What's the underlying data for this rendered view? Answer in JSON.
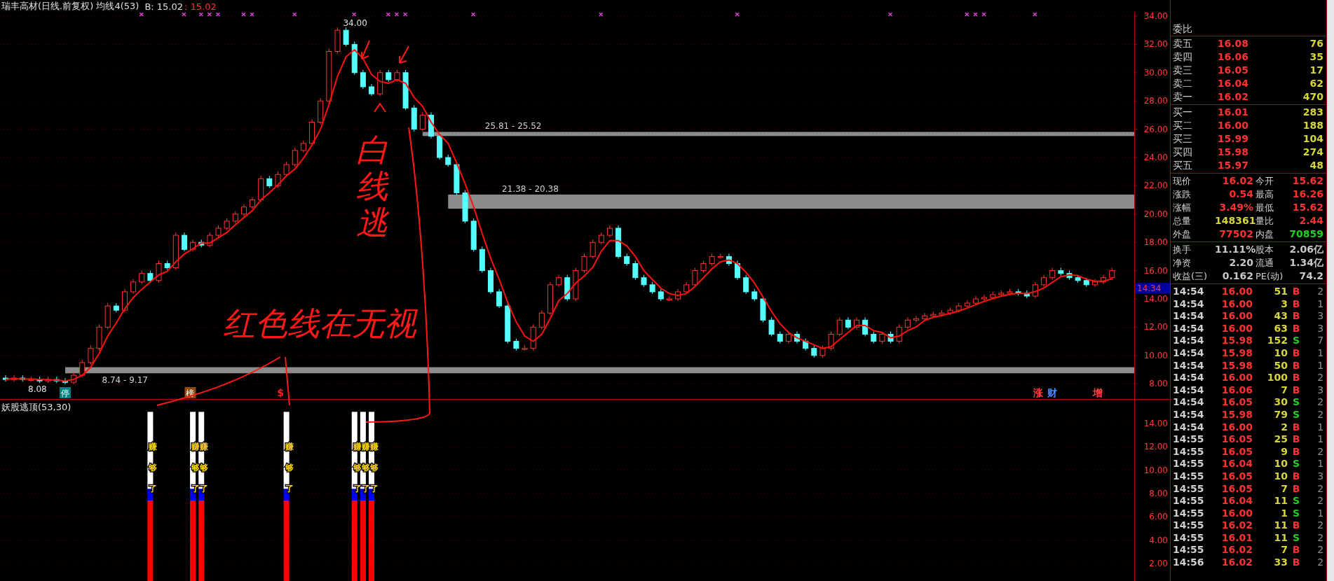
{
  "header": {
    "title": "瑞丰高材(日线.前复权) 均线4(53)",
    "reading": "B: 15.02",
    "reading_value": ": 15.02"
  },
  "main_chart": {
    "zones": [
      {
        "text": "25.81 - 25.52"
      },
      {
        "text": "21.38 - 20.38"
      },
      {
        "text": "8.74 - 9.17"
      }
    ],
    "price_labels": [
      "34.00",
      "8.08"
    ],
    "current_price": "14.34",
    "tags": [
      {
        "text": "停",
        "kind": "filled",
        "color": "#008080"
      },
      {
        "text": "榜",
        "kind": "filled",
        "color": "#8a4a10"
      },
      {
        "text": "$",
        "kind": "plain",
        "color": "#ff2020"
      },
      {
        "text": "涨",
        "kind": "plain",
        "color": "#ff4040"
      },
      {
        "text": "财",
        "kind": "plain",
        "color": "#4a8cff"
      },
      {
        "text": "增",
        "kind": "plain",
        "color": "#ff4040"
      }
    ],
    "axis_labels": [
      "34.00",
      "32.00",
      "30.00",
      "28.00",
      "26.00",
      "24.00",
      "22.00",
      "20.00",
      "18.00",
      "16.00",
      "14.00",
      "12.00",
      "10.00",
      "8.00"
    ]
  },
  "indicator": {
    "title": "妖股逃顶(53,30)",
    "axis_labels": [
      "14.00",
      "12.00",
      "10.00",
      "8.00",
      "6.00",
      "4.00",
      "2.00"
    ],
    "bar_labels": [
      "赚",
      "够",
      "了",
      "赚",
      "够",
      "了",
      "赚",
      "够",
      "了",
      "赚",
      "够",
      "了",
      "赚",
      "够",
      "了",
      "赚",
      "够",
      "了",
      "赚",
      "够",
      "了"
    ]
  },
  "quote_panel": {
    "order_ratio_label": "委比",
    "asks": [
      {
        "label": "卖五",
        "price": "16.08",
        "volume": "76"
      },
      {
        "label": "卖四",
        "price": "16.06",
        "volume": "35"
      },
      {
        "label": "卖三",
        "price": "16.05",
        "volume": "17"
      },
      {
        "label": "卖二",
        "price": "16.04",
        "volume": "62"
      },
      {
        "label": "卖一",
        "price": "16.02",
        "volume": "470"
      }
    ],
    "bids": [
      {
        "label": "买一",
        "price": "16.01",
        "volume": "283"
      },
      {
        "label": "买二",
        "price": "16.00",
        "volume": "188"
      },
      {
        "label": "买三",
        "price": "15.99",
        "volume": "104"
      },
      {
        "label": "买四",
        "price": "15.98",
        "volume": "274"
      },
      {
        "label": "买五",
        "price": "15.97",
        "volume": "48"
      }
    ],
    "stats": [
      {
        "cells": [
          {
            "label": "现价",
            "value": "16.02",
            "color": "#ff3232"
          },
          {
            "label": "今开",
            "value": "15.62",
            "color": "#ff3232"
          }
        ]
      },
      {
        "cells": [
          {
            "label": "涨跌",
            "value": "0.54",
            "color": "#ff3232"
          },
          {
            "label": "最高",
            "value": "16.26",
            "color": "#ff3232"
          }
        ]
      },
      {
        "cells": [
          {
            "label": "涨幅",
            "value": "3.49%",
            "color": "#ff3232"
          },
          {
            "label": "最低",
            "value": "15.62",
            "color": "#ff3232"
          }
        ]
      },
      {
        "cells": [
          {
            "label": "总量",
            "value": "148361",
            "color": "#d6d63c"
          },
          {
            "label": "量比",
            "value": "2.44",
            "color": "#ff3232"
          }
        ]
      },
      {
        "cells": [
          {
            "label": "外盘",
            "value": "77502",
            "color": "#ff3232"
          },
          {
            "label": "内盘",
            "value": "70859",
            "color": "#20d020"
          }
        ]
      }
    ],
    "fundamentals": [
      {
        "cells": [
          {
            "label": "换手",
            "value": "11.11%"
          },
          {
            "label": "股本",
            "value": "2.06亿"
          }
        ]
      },
      {
        "cells": [
          {
            "label": "净资",
            "value": "2.20"
          },
          {
            "label": "流通",
            "value": "1.34亿"
          }
        ]
      },
      {
        "cells": [
          {
            "label": "收益(三)",
            "value": "0.162"
          },
          {
            "label": "PE(动)",
            "value": "74.2"
          }
        ]
      }
    ]
  },
  "trades": [
    {
      "time": "14:54",
      "price": "16.00",
      "volume": "51",
      "side": "B",
      "kind": "buy",
      "column_5": "2"
    },
    {
      "time": "14:54",
      "price": "16.00",
      "volume": "3",
      "side": "B",
      "kind": "buy",
      "column_5": "1"
    },
    {
      "time": "14:54",
      "price": "16.00",
      "volume": "43",
      "side": "B",
      "kind": "buy",
      "column_5": "3"
    },
    {
      "time": "14:54",
      "price": "16.00",
      "volume": "63",
      "side": "B",
      "kind": "buy",
      "column_5": "3"
    },
    {
      "time": "14:54",
      "price": "15.98",
      "volume": "152",
      "side": "S",
      "kind": "sell",
      "column_5": "7"
    },
    {
      "time": "14:54",
      "price": "15.98",
      "volume": "10",
      "side": "B",
      "kind": "buy",
      "column_5": "1"
    },
    {
      "time": "14:54",
      "price": "15.98",
      "volume": "50",
      "side": "B",
      "kind": "buy",
      "column_5": "1"
    },
    {
      "time": "14:54",
      "price": "16.00",
      "volume": "100",
      "side": "B",
      "kind": "buy",
      "column_5": "2"
    },
    {
      "time": "14:54",
      "price": "16.06",
      "volume": "7",
      "side": "B",
      "kind": "buy",
      "column_5": "3"
    },
    {
      "time": "14:54",
      "price": "16.05",
      "volume": "30",
      "side": "S",
      "kind": "sell",
      "column_5": "2"
    },
    {
      "time": "14:54",
      "price": "15.98",
      "volume": "79",
      "side": "S",
      "kind": "sell",
      "column_5": "2"
    },
    {
      "time": "14:54",
      "price": "16.00",
      "volume": "2",
      "side": "B",
      "kind": "buy",
      "column_5": "1"
    },
    {
      "time": "14:55",
      "price": "16.05",
      "volume": "25",
      "side": "B",
      "kind": "buy",
      "column_5": "1"
    },
    {
      "time": "14:55",
      "price": "16.05",
      "volume": "9",
      "side": "B",
      "kind": "buy",
      "column_5": "2"
    },
    {
      "time": "14:55",
      "price": "16.04",
      "volume": "10",
      "side": "S",
      "kind": "sell",
      "column_5": "1"
    },
    {
      "time": "14:55",
      "price": "16.05",
      "volume": "10",
      "side": "B",
      "kind": "buy",
      "column_5": "3"
    },
    {
      "time": "14:55",
      "price": "16.05",
      "volume": "7",
      "side": "B",
      "kind": "buy",
      "column_5": "2"
    },
    {
      "time": "14:55",
      "price": "16.04",
      "volume": "11",
      "side": "S",
      "kind": "sell",
      "column_5": "2"
    },
    {
      "time": "14:55",
      "price": "16.00",
      "volume": "1",
      "side": "S",
      "kind": "sell",
      "column_5": "1"
    },
    {
      "time": "14:55",
      "price": "16.02",
      "volume": "11",
      "side": "B",
      "kind": "buy",
      "column_5": "2"
    },
    {
      "time": "14:55",
      "price": "16.01",
      "volume": "11",
      "side": "S",
      "kind": "sell",
      "column_5": "2"
    },
    {
      "time": "14:55",
      "price": "16.02",
      "volume": "7",
      "side": "B",
      "kind": "buy",
      "column_5": "2"
    },
    {
      "time": "14:56",
      "price": "16.02",
      "volume": "33",
      "side": "B",
      "kind": "buy",
      "column_5": "2"
    }
  ],
  "handwriting": [
    {
      "text": "白线逃"
    },
    {
      "text": "红色线在无视"
    }
  ]
}
